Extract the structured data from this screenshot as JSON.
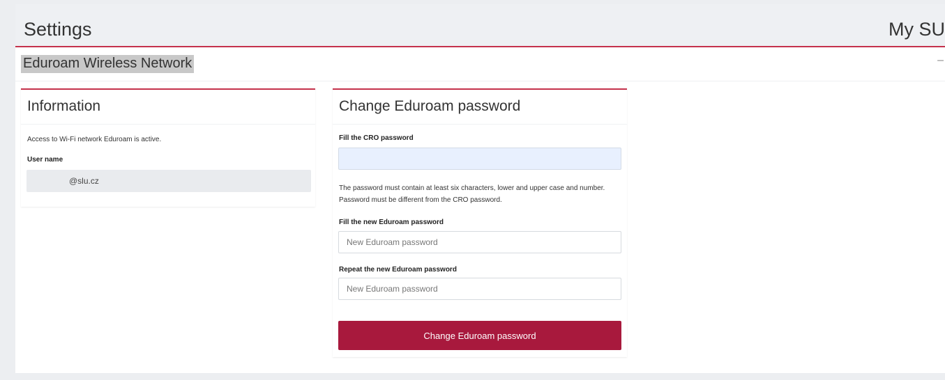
{
  "header": {
    "title": "Settings",
    "right_label": "My SU"
  },
  "section": {
    "title": "Eduroam Wireless Network",
    "collapse_label": "–"
  },
  "info_card": {
    "title": "Information",
    "status_text": "Access to Wi-Fi network Eduroam is active.",
    "username_label": "User name",
    "username_value": "@slu.cz"
  },
  "password_card": {
    "title": "Change Eduroam password",
    "cro_label": "Fill the CRO password",
    "cro_value": "",
    "help_text": "The password must contain at least six characters, lower and upper case and number. Password must be different from the CRO password.",
    "new_label": "Fill the new Eduroam password",
    "new_placeholder": "New Eduroam password",
    "repeat_label": "Repeat the new Eduroam password",
    "repeat_placeholder": "New Eduroam password",
    "submit_label": "Change Eduroam password"
  },
  "colors": {
    "accent": "#c4314b",
    "button": "#a8193d",
    "autofill": "#e8f0fe"
  }
}
